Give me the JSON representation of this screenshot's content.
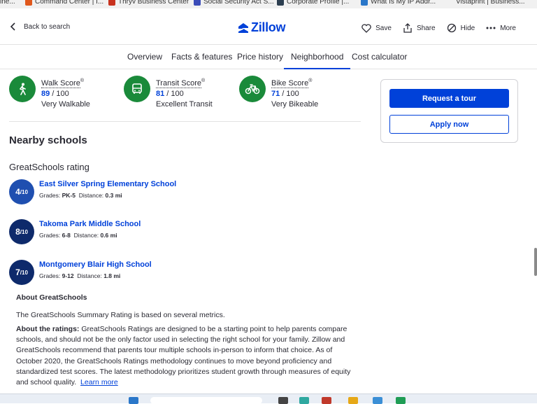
{
  "bookmarks": [
    {
      "label": "ine..."
    },
    {
      "label": "Command Center | I...",
      "color": "#e0581c"
    },
    {
      "label": "Thryv Business Center",
      "color": "#c8321e"
    },
    {
      "label": "Social Security Act S...",
      "color": "#3b4cb8"
    },
    {
      "label": "Corporate Profile |...",
      "color": "#2c3e50"
    },
    {
      "label": "What Is My IP Addr...",
      "color": "#2a77c9"
    },
    {
      "label": "Vistaprint | Business..."
    }
  ],
  "header": {
    "back_label": "Back to search",
    "logo_text": "Zillow",
    "actions": {
      "save": "Save",
      "share": "Share",
      "hide": "Hide",
      "more": "More"
    }
  },
  "tabs": [
    "Overview",
    "Facts & features",
    "Price history",
    "Neighborhood",
    "Cost calculator"
  ],
  "active_tab": "Neighborhood",
  "scores": [
    {
      "label": "Walk Score",
      "sup": "®",
      "value": "89",
      "max": " / 100",
      "desc": "Very Walkable",
      "icon": "walk-icon"
    },
    {
      "label": "Transit Score",
      "sup": "®",
      "value": "81",
      "max": " / 100",
      "desc": "Excellent Transit",
      "icon": "bus-icon"
    },
    {
      "label": "Bike Score",
      "sup": "®",
      "value": "71",
      "max": " / 100",
      "desc": "Very Bikeable",
      "icon": "bike-icon"
    }
  ],
  "cta": {
    "tour": "Request a tour",
    "apply": "Apply now"
  },
  "schools_title": "Nearby schools",
  "rating_title": "GreatSchools rating",
  "schools": [
    {
      "rating": "4",
      "out_of": "/10",
      "name": "East Silver Spring Elementary School",
      "grades_label": "Grades:",
      "grades": "PK-5",
      "distance_label": "Distance:",
      "distance": "0.3 mi",
      "color": "#1f4fb0"
    },
    {
      "rating": "8",
      "out_of": "/10",
      "name": "Takoma Park Middle School",
      "grades_label": "Grades:",
      "grades": "6-8",
      "distance_label": "Distance:",
      "distance": "0.6 mi",
      "color": "#0e2a6b"
    },
    {
      "rating": "7",
      "out_of": "/10",
      "name": "Montgomery Blair High School",
      "grades_label": "Grades:",
      "grades": "9-12",
      "distance_label": "Distance:",
      "distance": "1.8 mi",
      "color": "#0e2a6b"
    }
  ],
  "about": {
    "heading": "About GreatSchools",
    "summary": "The GreatSchools Summary Rating is based on several metrics.",
    "ratings_label": "About the ratings:",
    "ratings_text": " GreatSchools Ratings are designed to be a starting point to help parents compare schools, and should not be the only factor used in selecting the right school for your family. Zillow and GreatSchools recommend that parents tour multiple schools in-person to inform that choice. As of October 2020, the GreatSchools Ratings methodology continues to move beyond proficiency and standardized test scores. The latest methodology prioritizes student growth through measures of equity and school quality.",
    "learn_more": "Learn more"
  }
}
